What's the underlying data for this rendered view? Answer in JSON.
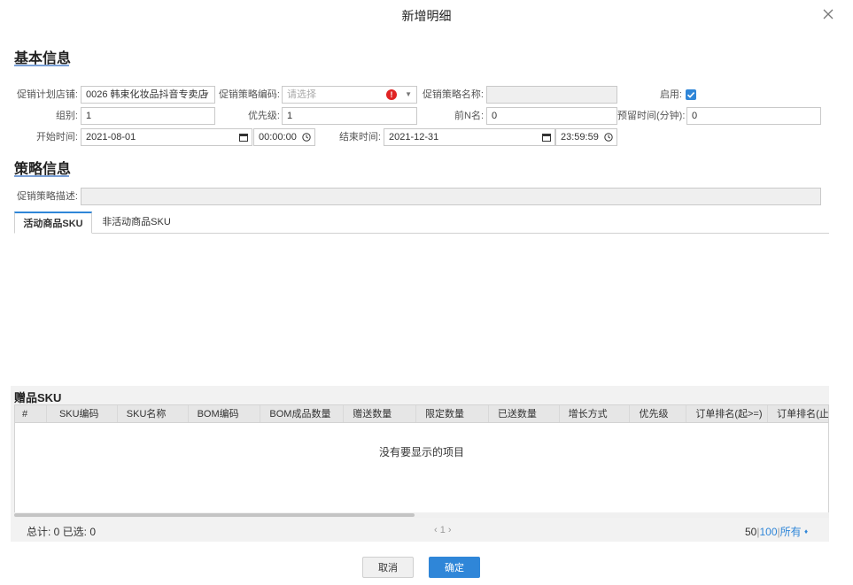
{
  "dialog": {
    "title": "新增明细"
  },
  "basic": {
    "section_title": "基本信息",
    "store_label": "促销计划店铺:",
    "store_value": "0026 韩束化妆品抖音专卖店",
    "code_label": "促销策略编码:",
    "code_placeholder": "请选择",
    "name_label": "促销策略名称:",
    "name_value": "",
    "enable_label": "启用:",
    "enabled": true,
    "group_label": "组别:",
    "group_value": "1",
    "priority_label": "优先级:",
    "priority_value": "1",
    "topn_label": "前N名:",
    "topn_value": "0",
    "reserve_label": "预留时间(分钟):",
    "reserve_value": "0",
    "start_label": "开始时间:",
    "start_date": "2021-08-01",
    "start_time": "00:00:00",
    "end_label": "结束时间:",
    "end_date": "2021-12-31",
    "end_time": "23:59:59"
  },
  "strategy": {
    "section_title": "策略信息",
    "desc_label": "促销策略描述:",
    "desc_value": "",
    "tabs": [
      {
        "label": "活动商品SKU",
        "active": true
      },
      {
        "label": "非活动商品SKU",
        "active": false
      }
    ]
  },
  "gift": {
    "title": "赠品SKU",
    "columns": [
      "#",
      "SKU编码",
      "SKU名称",
      "BOM编码",
      "BOM成品数量",
      "赠送数量",
      "限定数量",
      "已送数量",
      "增长方式",
      "优先级",
      "订单排名(起>=)",
      "订单排名(止"
    ],
    "empty_text": "没有要显示的项目",
    "footer_summary": "总计: 0 已选: 0",
    "pager": "‹ 1 ›",
    "page_size_50": "50",
    "page_size_100": "100",
    "page_size_all": "所有"
  },
  "buttons": {
    "cancel": "取消",
    "ok": "确定"
  },
  "colors": {
    "accent": "#2f86d8",
    "error": "#e02424"
  }
}
